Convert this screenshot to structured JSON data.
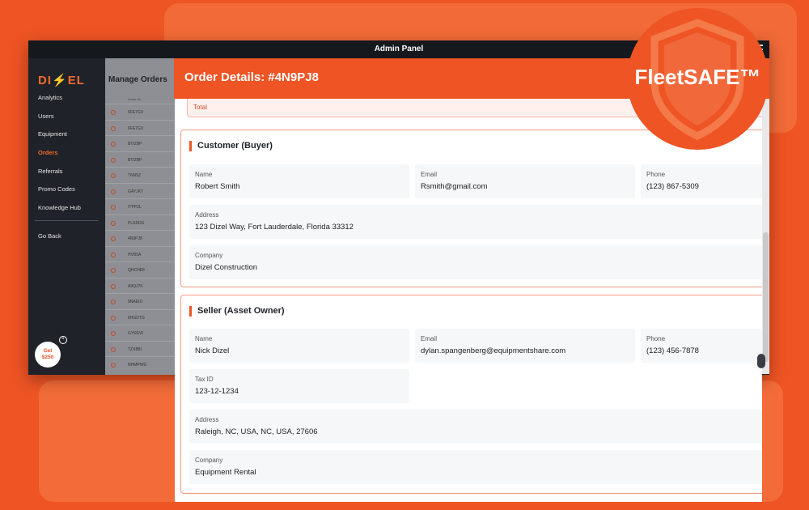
{
  "window": {
    "title": "Admin Panel"
  },
  "sidebar": {
    "logo_left": "DI",
    "logo_bolt": "⚡",
    "logo_right": "EL",
    "items": [
      {
        "label": "Analytics"
      },
      {
        "label": "Users"
      },
      {
        "label": "Equipment"
      },
      {
        "label": "Orders"
      },
      {
        "label": "Referrals"
      },
      {
        "label": "Promo Codes"
      },
      {
        "label": "Knowledge Hub"
      }
    ],
    "go_back": "Go Back",
    "promo_line1": "Get",
    "promo_line2": "$250"
  },
  "orders": {
    "title": "Manage Orders",
    "column": "Order ##",
    "ids": [
      "6FE7GV",
      "6FE7GV",
      "BTIZBP",
      "BTIZBP",
      "TNN5Z",
      "GAYJKT",
      "ITPPZL",
      "PLSDDS",
      "4N9PJ8",
      "HVB5A",
      "QHCHE8",
      "A9QJ7K",
      "9NAEIO",
      "6HGDTG",
      "GYREW",
      "TZX8BI",
      "NHMPWG"
    ]
  },
  "modal": {
    "title": "Order Details: #4N9PJ8",
    "total_label": "Total",
    "buyer": {
      "heading": "Customer (Buyer)",
      "name_label": "Name",
      "name": "Robert Smith",
      "email_label": "Email",
      "email": "Rsmith@gmail.com",
      "phone_label": "Phone",
      "phone": "(123) 867-5309",
      "address_label": "Address",
      "address": "123 Dizel Way, Fort Lauderdale, Florida 33312",
      "company_label": "Company",
      "company": "Dizel Construction"
    },
    "seller": {
      "heading": "Seller (Asset Owner)",
      "name_label": "Name",
      "name": "Nick Dizel",
      "email_label": "Email",
      "email": "dylan.spangenberg@equipmentshare.com",
      "phone_label": "Phone",
      "phone": "(123) 456-7878",
      "taxid_label": "Tax ID",
      "taxid": "123-12-1234",
      "address_label": "Address",
      "address": "Raleigh, NC, USA, NC, USA, 27606",
      "company_label": "Company",
      "company": "Equipment Rental"
    }
  },
  "badge": {
    "text": "FleetSAFE™"
  },
  "colors": {
    "accent": "#ee5424",
    "sidebar": "#1f2228",
    "badge_shield": "#f47a4a"
  }
}
